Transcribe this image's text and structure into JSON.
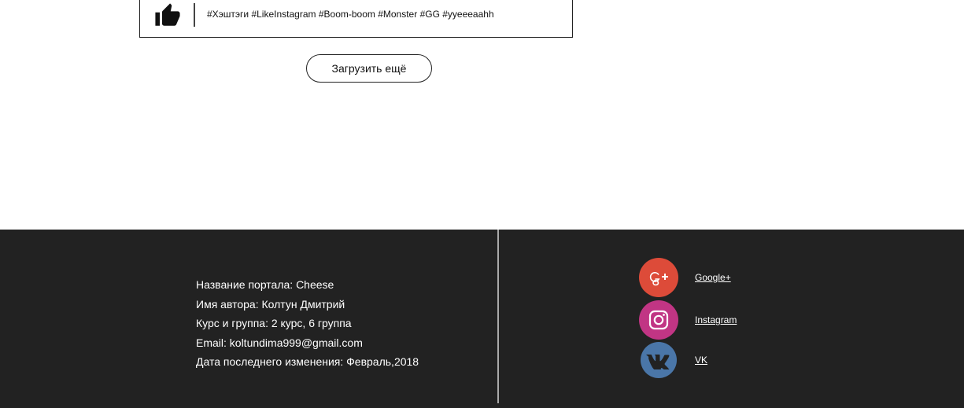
{
  "post": {
    "hashtags": "#Хэштэги #LikeInstagram #Boom-boom #Monster #GG #yyeeeaahh",
    "like_icon": "thumbs-up-icon"
  },
  "load_more": {
    "label": "Загрузить ещё"
  },
  "footer": {
    "info": [
      "Название портала: Cheese",
      "Имя автора: Колтун Дмитрий",
      "Курс и группа: 2 курс, 6 группа",
      "Email: koltundima999@gmail.com",
      "Дата последнего изменения: Февраль,2018"
    ],
    "social": [
      {
        "label": "Google+",
        "icon": "google-plus-icon",
        "color": "#dd4b39"
      },
      {
        "label": "Instagram",
        "icon": "instagram-icon",
        "color": "#c13584"
      },
      {
        "label": "VK",
        "icon": "vk-icon",
        "color": "#4a76a8"
      }
    ]
  },
  "colors": {
    "footer_bg": "#222222",
    "text_light": "#ffffff"
  }
}
